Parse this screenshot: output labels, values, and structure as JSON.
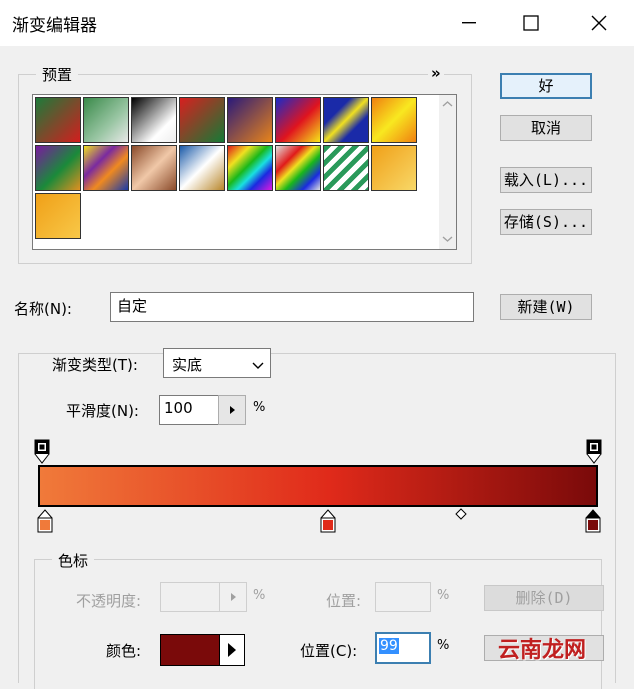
{
  "title": "渐变编辑器",
  "buttons": {
    "ok": "好",
    "cancel": "取消",
    "load": "载入(L)...",
    "save": "存储(S)...",
    "new": "新建(W)",
    "delete": "删除(D)"
  },
  "presets": {
    "legend": "预置",
    "menu_glyph": "»",
    "swatches": [
      {
        "name": "foreground-background",
        "bg": "linear-gradient(135deg,#1d7a3a,#d21e1e)"
      },
      {
        "name": "foreground-transparent",
        "bg": "linear-gradient(135deg,#3a8a4a,#9ac6a4 60%,#e8e8e8)"
      },
      {
        "name": "black-white",
        "bg": "linear-gradient(135deg,#000,#fff 70%,#eee)"
      },
      {
        "name": "red-green",
        "bg": "linear-gradient(135deg,#d81f1f,#157a36)"
      },
      {
        "name": "violet-orange",
        "bg": "linear-gradient(135deg,#2a1a7a,#e8841a)"
      },
      {
        "name": "blue-red-yellow",
        "bg": "linear-gradient(135deg,#1a2ac8,#e0141e 55%,#f5e81a)"
      },
      {
        "name": "blue-yellow-blue",
        "bg": "linear-gradient(135deg,#1a2aa8 30%,#f0e020 50%,#1a2aa8 70%)"
      },
      {
        "name": "orange-yellow-orange",
        "bg": "linear-gradient(135deg,#f08010,#f8e820 50%,#f08010)"
      },
      {
        "name": "violet-green-orange",
        "bg": "linear-gradient(135deg,#7a1aa0,#1a8a3a 55%,#e09020)"
      },
      {
        "name": "yellow-violet-orange-blue",
        "bg": "linear-gradient(135deg,#f0e020,#7a2aa0 35%,#f08a20 60%,#1a3aa8)"
      },
      {
        "name": "copper",
        "bg": "linear-gradient(135deg,#8a4a2a,#f0c8a8 50%,#8a4a2a)"
      },
      {
        "name": "chrome",
        "bg": "linear-gradient(135deg,#1a5aa8,#ffffff 50%,#b8862a)"
      },
      {
        "name": "spectrum",
        "bg": "linear-gradient(135deg,#e01a1a,#f0e020 25%,#1ab81a 45%,#1ae0e0 60%,#1a2ae0 75%,#e01ae0)"
      },
      {
        "name": "transparent-rainbow",
        "bg": "linear-gradient(135deg,#e0e0e0,#e01a1a 30%,#f0e020 45%,#1ab81a 60%,#1a2ae0 80%,#e0e0e0)"
      },
      {
        "name": "transparent-stripes",
        "bg": "repeating-linear-gradient(135deg,#2a9a5a 0 5px,#ffffff 5px 10px)"
      },
      {
        "name": "orange-yellow",
        "bg": "linear-gradient(135deg,#f0a018,#f8d868)"
      },
      {
        "name": "custom-orange",
        "bg": "linear-gradient(135deg,#f0a018,#f8c848)"
      }
    ]
  },
  "name_field": {
    "label": "名称(N):",
    "value": "自定"
  },
  "gradient_type": {
    "label": "渐变类型(T):",
    "value": "实底"
  },
  "smoothness": {
    "label": "平滑度(N):",
    "value": "100",
    "unit": "%"
  },
  "gradient": {
    "colors": [
      "#f07a3a",
      "#e02a1a",
      "#7a0a0a"
    ],
    "color_stops": [
      {
        "position": 0,
        "color": "#f07a3a"
      },
      {
        "position": 52,
        "color": "#e02a1a"
      },
      {
        "position": 100,
        "color": "#7a0a0a"
      }
    ],
    "opacity_stops": [
      0,
      100
    ],
    "midpoint": 75
  },
  "color_stop_group": {
    "legend": "色标",
    "opacity_label": "不透明度:",
    "opacity_unit": "%",
    "location_label_1": "位置:",
    "location_unit_1": "%",
    "color_label": "颜色:",
    "color_value": "#7a0a0a",
    "location_label_2": "位置(C):",
    "location_value": "99",
    "location_unit_2": "%"
  },
  "watermark": "云南龙网"
}
